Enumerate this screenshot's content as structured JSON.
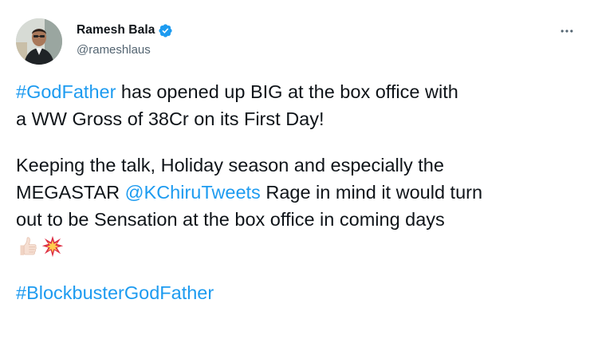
{
  "author": {
    "display_name": "Ramesh Bala",
    "handle": "@rameshlaus",
    "verified": true
  },
  "icons": {
    "verified": "verified-badge-icon",
    "more": "more-horizontal-icon",
    "emoji_1": "thumbs-up-light-skin-emoji",
    "emoji_2": "collision-emoji"
  },
  "colors": {
    "link": "#1d9bf0",
    "text": "#0f1419",
    "secondary": "#536471"
  },
  "tweet": {
    "p1": {
      "hashtag": "#GodFather",
      "line1_rest": " has opened up BIG at the box office with",
      "line2": "a WW Gross of 38Cr on its First Day!"
    },
    "p2": {
      "line1": "Keeping the talk, Holiday season and especially the",
      "line2_pre": "MEGASTAR ",
      "mention": "@KChiruTweets",
      "line2_post": " Rage in mind it would turn",
      "line3": "out to be Sensation at the box office in coming days"
    },
    "p3": {
      "hashtag": "#BlockbusterGodFather"
    }
  }
}
